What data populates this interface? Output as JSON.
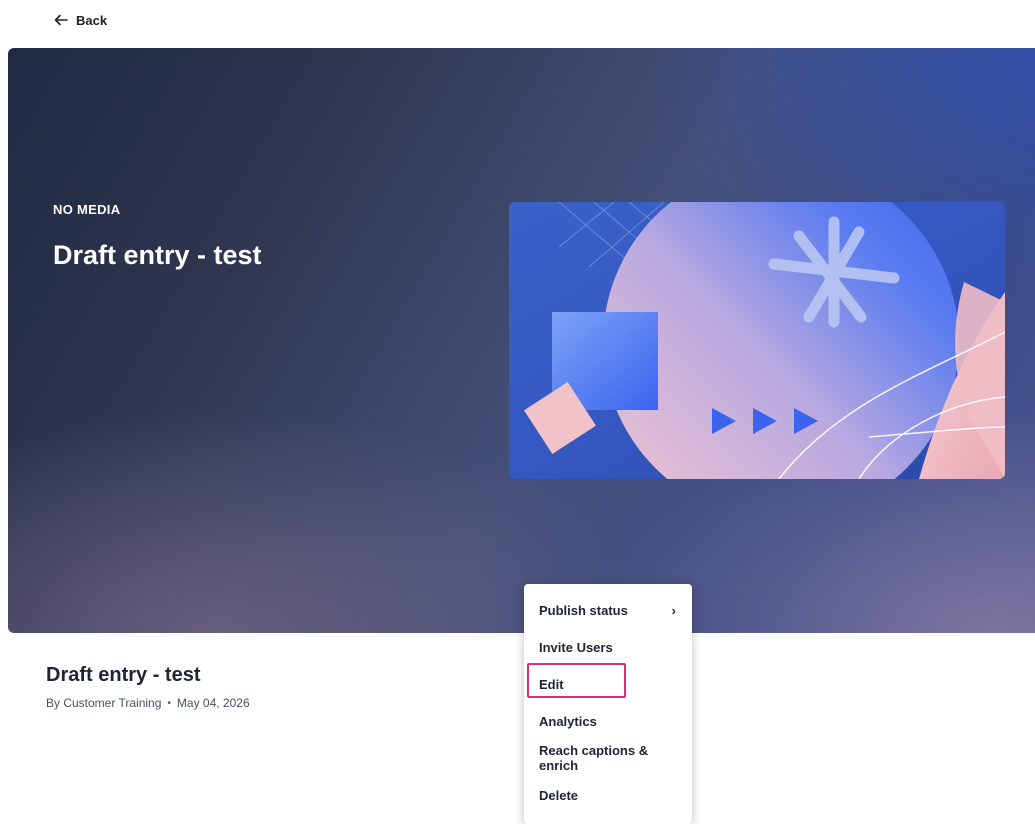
{
  "nav": {
    "back_label": "Back"
  },
  "hero": {
    "kicker": "NO MEDIA",
    "title": "Draft entry - test"
  },
  "entry": {
    "title": "Draft entry - test",
    "author": "By Customer Training",
    "separator": "•",
    "date": "May 04, 2026"
  },
  "menu": {
    "items": [
      {
        "label": "Publish status",
        "chevron": "›"
      },
      {
        "label": "Invite Users"
      },
      {
        "label": "Edit"
      },
      {
        "label": "Analytics"
      },
      {
        "label": "Reach captions & enrich"
      },
      {
        "label": "Delete"
      }
    ]
  },
  "colors": {
    "focus": "#d0337d",
    "accent_blue": "#3d6bf2",
    "accent_pink": "#f1c2cb"
  }
}
